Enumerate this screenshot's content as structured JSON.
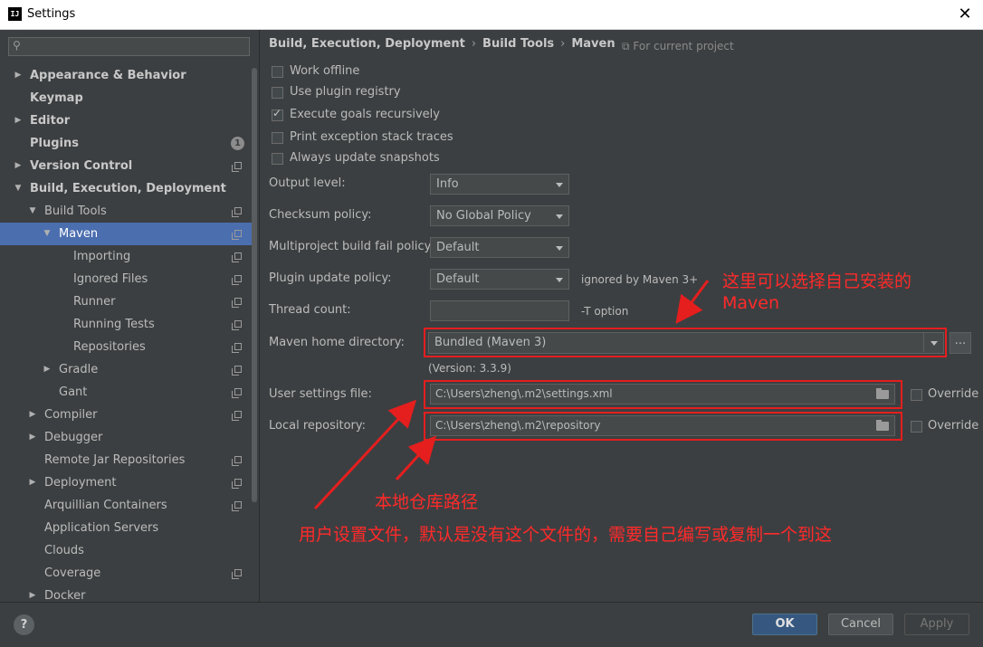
{
  "window": {
    "title": "Settings",
    "app_icon": "IJ"
  },
  "search": {
    "placeholder": ""
  },
  "sidebar": {
    "items": [
      {
        "label": "Appearance & Behavior",
        "bold": true,
        "arrow": "right"
      },
      {
        "label": "Keymap",
        "bold": true
      },
      {
        "label": "Editor",
        "bold": true,
        "arrow": "right"
      },
      {
        "label": "Plugins",
        "bold": true,
        "badge": "1"
      },
      {
        "label": "Version Control",
        "bold": true,
        "arrow": "right"
      },
      {
        "label": "Build, Execution, Deployment",
        "bold": true,
        "arrow": "down"
      },
      {
        "label": "Build Tools",
        "arrow": "down"
      },
      {
        "label": "Maven",
        "arrow": "down",
        "selected": true
      },
      {
        "label": "Importing"
      },
      {
        "label": "Ignored Files"
      },
      {
        "label": "Runner"
      },
      {
        "label": "Running Tests"
      },
      {
        "label": "Repositories"
      },
      {
        "label": "Gradle",
        "arrow": "right"
      },
      {
        "label": "Gant"
      },
      {
        "label": "Compiler",
        "arrow": "right"
      },
      {
        "label": "Debugger",
        "arrow": "right"
      },
      {
        "label": "Remote Jar Repositories"
      },
      {
        "label": "Deployment",
        "arrow": "right"
      },
      {
        "label": "Arquillian Containers"
      },
      {
        "label": "Application Servers"
      },
      {
        "label": "Clouds"
      },
      {
        "label": "Coverage"
      },
      {
        "label": "Docker",
        "arrow": "right"
      }
    ]
  },
  "breadcrumb": {
    "part1": "Build, Execution, Deployment",
    "part2": "Build Tools",
    "part3": "Maven",
    "separator": "›"
  },
  "scope_note": "For current project",
  "checkboxes": [
    {
      "label": "Work offline",
      "checked": false
    },
    {
      "label": "Use plugin registry",
      "checked": false
    },
    {
      "label": "Execute goals recursively",
      "checked": true
    },
    {
      "label": "Print exception stack traces",
      "checked": false
    },
    {
      "label": "Always update snapshots",
      "checked": false
    }
  ],
  "fields": {
    "output_level": {
      "label": "Output level:",
      "value": "Info"
    },
    "checksum_policy": {
      "label": "Checksum policy:",
      "value": "No Global Policy"
    },
    "multiproject_fail_policy": {
      "label": "Multiproject build fail policy:",
      "value": "Default"
    },
    "plugin_update_policy": {
      "label": "Plugin update policy:",
      "value": "Default",
      "note": "ignored by Maven 3+"
    },
    "thread_count": {
      "label": "Thread count:",
      "value": "",
      "note": "-T option"
    },
    "maven_home": {
      "label": "Maven home directory:",
      "value": "Bundled (Maven 3)",
      "version": "(Version: 3.3.9)",
      "browse": "..."
    },
    "user_settings": {
      "label": "User settings file:",
      "value": "C:\\Users\\zheng\\.m2\\settings.xml",
      "override": "Override",
      "override_checked": false
    },
    "local_repo": {
      "label": "Local repository:",
      "value": "C:\\Users\\zheng\\.m2\\repository",
      "override": "Override",
      "override_checked": false
    }
  },
  "annotations": {
    "maven_line1": "这里可以选择自己安装的",
    "maven_line2": "Maven",
    "local_repo": "本地仓库路径",
    "settings_file": "用户设置文件，默认是没有这个文件的，需要自己编写或复制一个到这"
  },
  "footer": {
    "help": "?",
    "ok": "OK",
    "cancel": "Cancel",
    "apply": "Apply"
  },
  "colors": {
    "background": "#3c3f41",
    "selection": "#4b6eaf",
    "annotation_red": "#e51e1e",
    "primary_button": "#365880"
  }
}
